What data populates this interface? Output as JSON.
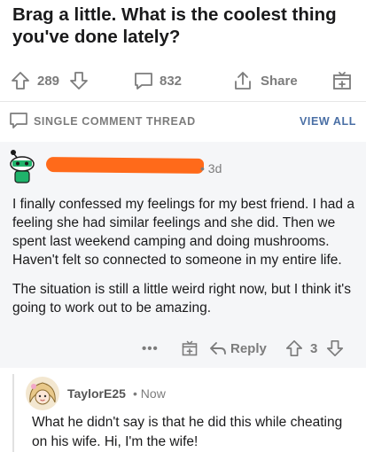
{
  "post": {
    "title": "Brag a little. What is the coolest thing you've done lately?",
    "votes": "289",
    "comments": "832",
    "share_label": "Share"
  },
  "thread": {
    "label": "SINGLE COMMENT THREAD",
    "view_all": "VIEW ALL"
  },
  "comment": {
    "time": "3d",
    "paragraphs": [
      "I finally confessed my feelings for my best friend. I had a feeling she had similar feelings and she did. Then we spent last weekend camping and doing mushrooms. Haven't felt so connected to someone in my entire life.",
      "The situation is still a little weird right now, but I think it's going to work out to be amazing."
    ],
    "more": "•••",
    "reply_label": "Reply",
    "votes": "3"
  },
  "reply": {
    "author": "TaylorE25",
    "time": "Now",
    "text": "What he didn't say is that he did this while cheating on his wife. Hi, I'm the wife!"
  },
  "colors": {
    "redaction": "#ff6a1a",
    "muted": "#7c7c7c",
    "link": "#4a6fa5",
    "comment_bg": "#f5f6f8"
  }
}
